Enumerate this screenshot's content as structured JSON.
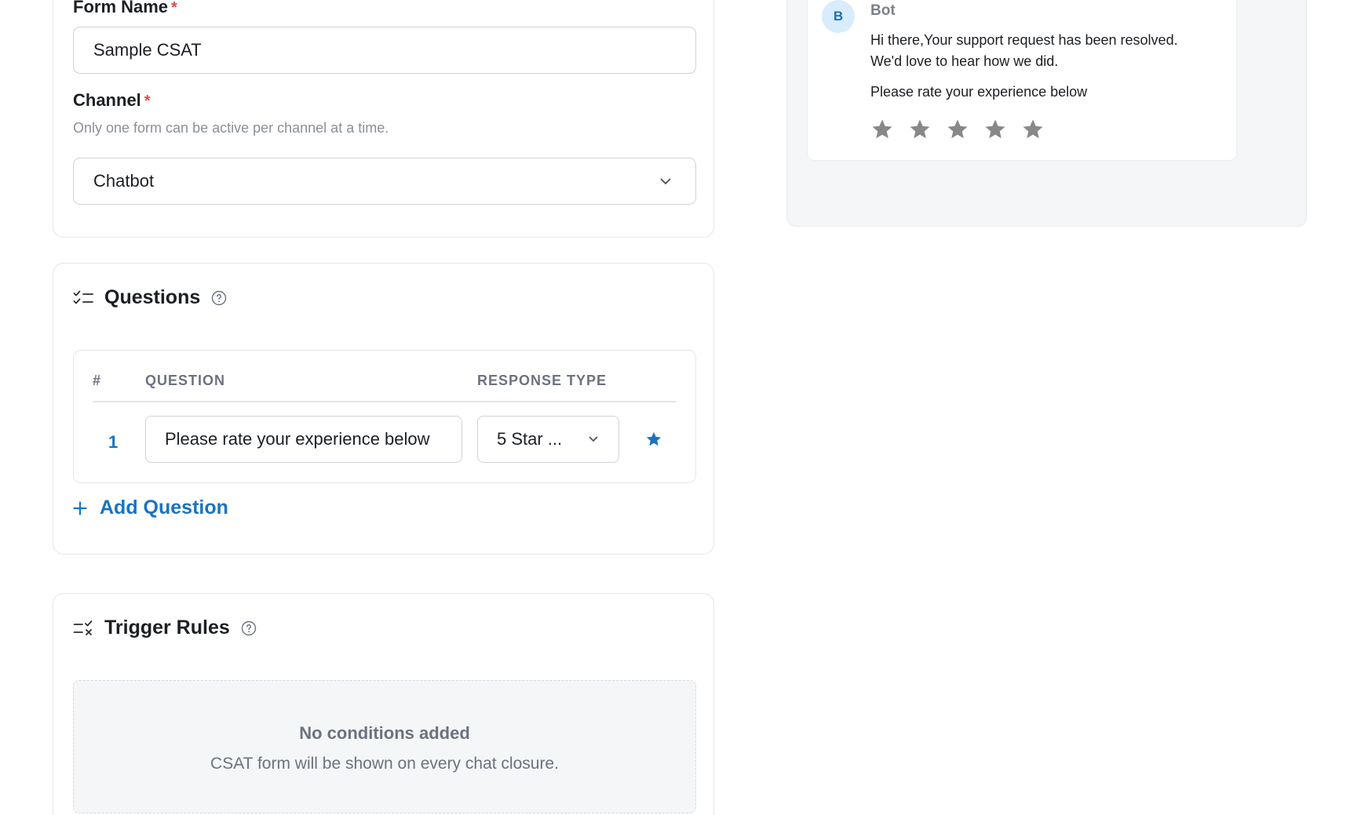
{
  "form": {
    "name_label": "Form Name",
    "required_mark": "*",
    "name_value": "Sample CSAT",
    "channel_label": "Channel",
    "channel_help": "Only one form can be active per channel at a time.",
    "channel_value": "Chatbot",
    "icons": {
      "dropdown": "chevron-down-icon"
    }
  },
  "questions": {
    "title": "Questions",
    "icon": "checklist-icon",
    "help_icon": "question-circle-icon",
    "columns": {
      "number": "#",
      "question": "QUESTION",
      "response_type": "RESPONSE TYPE"
    },
    "rows": [
      {
        "number": "1",
        "question": "Please rate your experience below",
        "response_type": "5 Star ..."
      }
    ],
    "add_label": "Add Question"
  },
  "trigger_rules": {
    "title": "Trigger Rules",
    "icon": "list-close-icon",
    "help_icon": "question-circle-icon",
    "empty_title": "No conditions added",
    "empty_subtitle": "CSAT form will be shown on every chat closure."
  },
  "preview": {
    "avatar_initial": "B",
    "bot_name": "Bot",
    "message_line1": "Hi there,Your support request has been resolved.",
    "message_line2": "We'd love to hear how we did.",
    "prompt": "Please rate your experience below",
    "star_count": 5
  },
  "colors": {
    "accent": "#1a73c0",
    "required": "#e5484d",
    "star_preview": "#888888",
    "panel_bg": "#f5f6f8"
  }
}
